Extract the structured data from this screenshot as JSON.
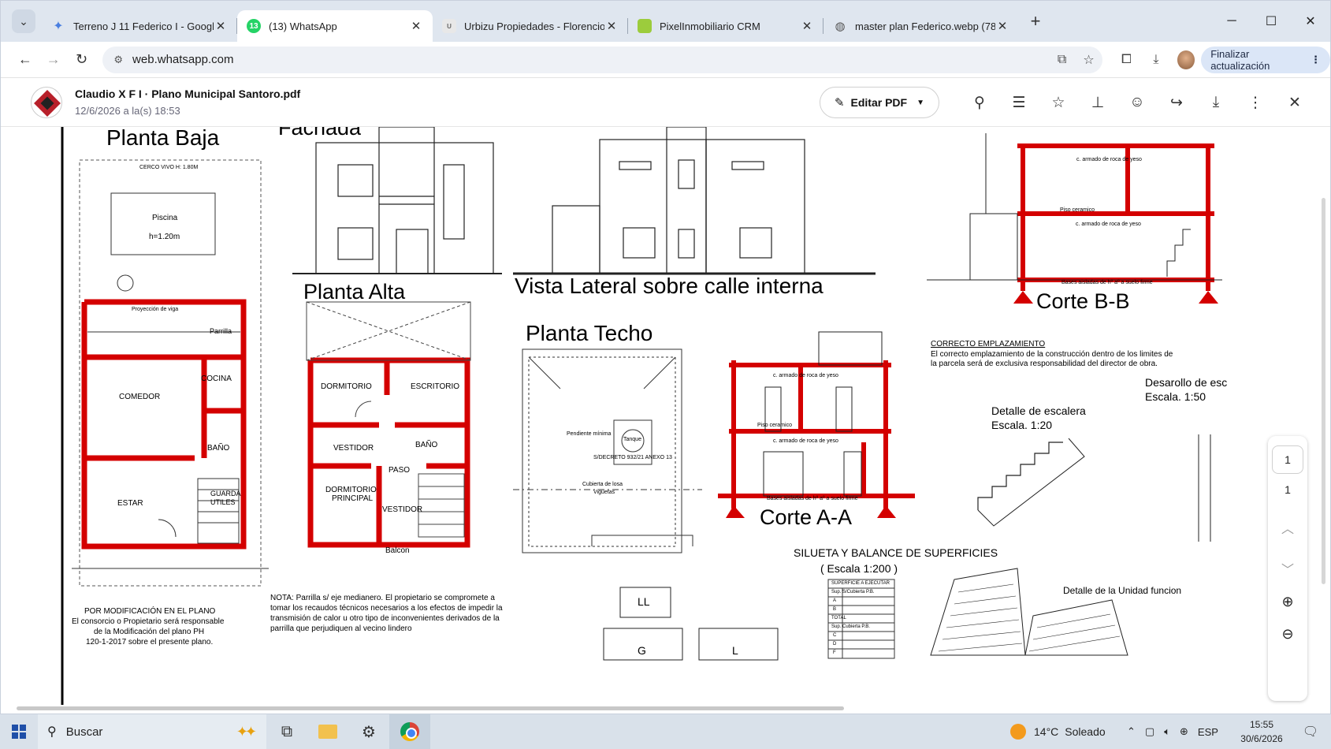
{
  "browser": {
    "tabs": [
      {
        "title": "Terreno J 11 Federico I - Google",
        "favicon": "gemini-sparkle-icon",
        "color": "#4a7fe0"
      },
      {
        "title": "(13) WhatsApp",
        "favicon": "whatsapp-icon",
        "color": "#25d366",
        "badge": "13"
      },
      {
        "title": "Urbizu Propiedades - Florencio",
        "favicon": "urbizu-icon",
        "color": "#888888"
      },
      {
        "title": "PixelInmobiliario CRM",
        "favicon": "crm-icon",
        "color": "#9ccc3c"
      },
      {
        "title": "master plan Federico.webp (78",
        "favicon": "globe-icon",
        "color": "#555555"
      }
    ],
    "url": "web.whatsapp.com",
    "update_button": "Finalizar actualización"
  },
  "viewer": {
    "title": "Claudio X F I · Plano Municipal Santoro.pdf",
    "timestamp": "12/6/2026 a la(s) 18:53",
    "edit_pdf_label": "Editar PDF"
  },
  "document": {
    "labels": {
      "planta_baja": "Planta Baja",
      "fachada": "Fachada",
      "planta_alta": "Planta Alta",
      "vista_lateral": "Vista Lateral sobre calle interna",
      "planta_techo": "Planta Techo",
      "corte_bb": "Corte B-B",
      "corte_aa": "Corte A-A",
      "correcto_title": "CORRECTO EMPLAZAMIENTO",
      "correcto_l1": "El correcto emplazamiento de la construcción dentro de los limites de",
      "correcto_l2": "la parcela será de exclusiva responsabilidad del director de obra.",
      "detalle_escalera": "Detalle de escalera",
      "escala_120": "Escala. 1:20",
      "desarrollo": "Desarollo de esc",
      "escala_150": "Escala. 1:50",
      "silueta": "SILUETA Y BALANCE DE SUPERFICIES",
      "escala_1200": "( Escala 1:200 )",
      "detalle_unidad": "Detalle de la Unidad funcion",
      "mod_l1": "POR MODIFICACIÓN EN EL PLANO",
      "mod_l2": "El consorcio o Propietario será responsable",
      "mod_l3": "de la Modificación del plano PH",
      "mod_l4": "120-1-2017 sobre el presente plano.",
      "nota_l1": "NOTA: Parrilla s/ eje medianero. El propietario se compromete a",
      "nota_l2": "tomar los recaudos técnicos necesarios a los efectos de impedir la",
      "nota_l3": "transmisión de calor u otro tipo de inconvenientes derivados de la",
      "nota_l4": "parrilla que perjudiquen al vecino lindero",
      "comedor": "COMEDOR",
      "cocina": "COCINA",
      "estar": "ESTAR",
      "bano": "BAÑO",
      "guarda": "GUARDA",
      "utiles": "UTILES",
      "piscina": "Piscina",
      "piscina_h": "h=1.20m",
      "dormitorio": "DORMITORIO",
      "escritorio": "ESCRITORIO",
      "vestidor": "VESTIDOR",
      "dorm_principal": "DORMITORIO",
      "principal": "PRINCIPAL",
      "paso": "PASO",
      "balcon": "Balcon",
      "tanque": "Tanque",
      "pendiente": "Pendiente mínima",
      "cubierta": "Cubierta de losa",
      "viguetas": "Viguetas",
      "sdecreto": "S/DECRETO 932/21 ANEXO 13",
      "cerco_vivo": "CERCO VIVO H: 1.80M",
      "parrilla": "Parrilla",
      "proy_viga": "Proyección de viga",
      "armado_roca": "c. armado de roca de yeso",
      "piso_ceramico": "Piso ceramico",
      "bases": "Bases aisladas de hº aº a suelo firme",
      "lbl_G": "G",
      "lbl_L": "L",
      "lbl_LL": "LL"
    },
    "table_rows": [
      "SUPERFICIE A EJECUTAR",
      "Sup. S/Cubierta P.B.",
      "A",
      "B",
      "TOTAL",
      "Sup. Cubierta P.B.",
      "C",
      "D",
      "F"
    ],
    "page_nav": {
      "current": "1",
      "total": "1"
    }
  },
  "taskbar": {
    "search_placeholder": "Buscar",
    "weather_temp": "14°C",
    "weather_desc": "Soleado",
    "lang": "ESP",
    "time": "15:55",
    "date": "30/6/2026"
  }
}
